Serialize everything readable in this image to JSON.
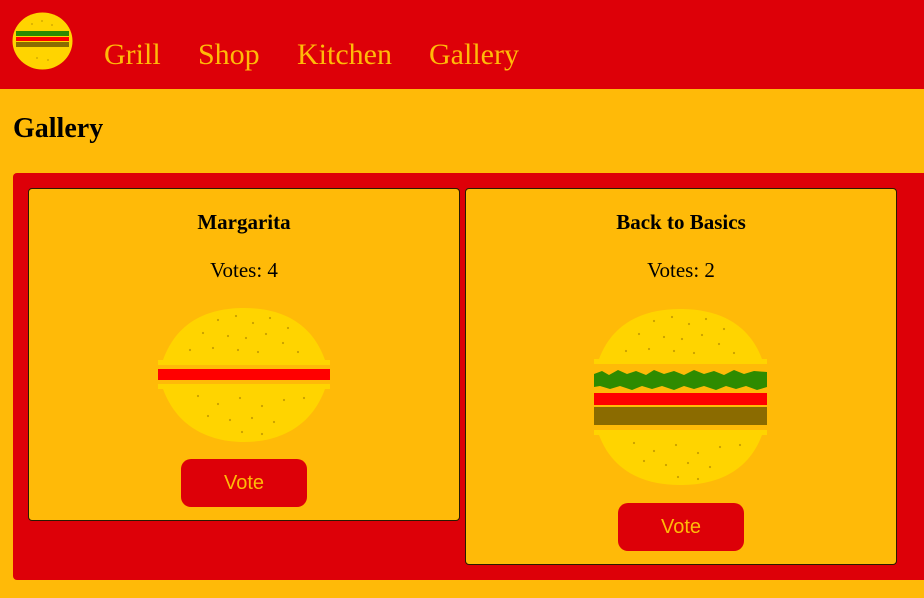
{
  "nav": {
    "logo_icon": "burger-logo-icon",
    "links": [
      "Grill",
      "Shop",
      "Kitchen",
      "Gallery"
    ]
  },
  "page": {
    "title": "Gallery"
  },
  "gallery": {
    "items": [
      {
        "name": "Margarita",
        "votes_text": "Votes: 4",
        "votes": 4,
        "layers": [
          "tomato"
        ],
        "vote_label": "Vote"
      },
      {
        "name": "Back to Basics",
        "votes_text": "Votes: 2",
        "votes": 2,
        "layers": [
          "lettuce",
          "tomato",
          "patty"
        ],
        "vote_label": "Vote"
      }
    ]
  },
  "colors": {
    "primary_red": "#DD0008",
    "primary_yellow": "#FFBA08",
    "bun": "#FFD400",
    "seed": "#C9A000",
    "tomato": "#FF0000",
    "lettuce": "#2E8B00",
    "patty": "#8B6B00"
  }
}
